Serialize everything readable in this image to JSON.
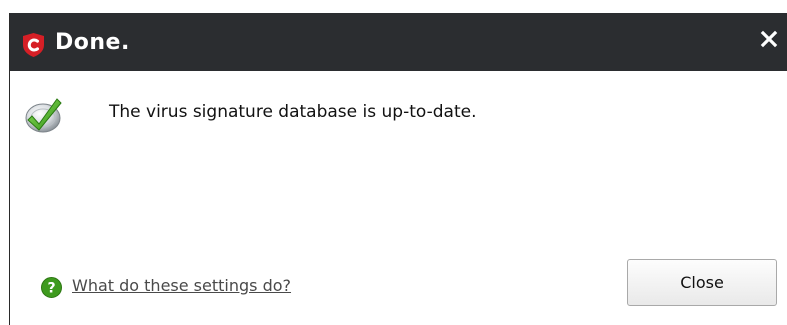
{
  "window": {
    "title": "Done.",
    "logo_icon": "comodo-shield-icon",
    "close_icon": "close-icon"
  },
  "message": {
    "icon": "update-check-icon",
    "text": "The virus signature database is up-to-date."
  },
  "footer": {
    "help_icon": "help-icon",
    "help_link_text": "What do these settings do?",
    "close_button_label": "Close"
  },
  "colors": {
    "titlebar": "#2b2d30",
    "brand_red": "#d61f26",
    "help_green": "#3e9a1e",
    "check_green": "#4fb22b"
  }
}
